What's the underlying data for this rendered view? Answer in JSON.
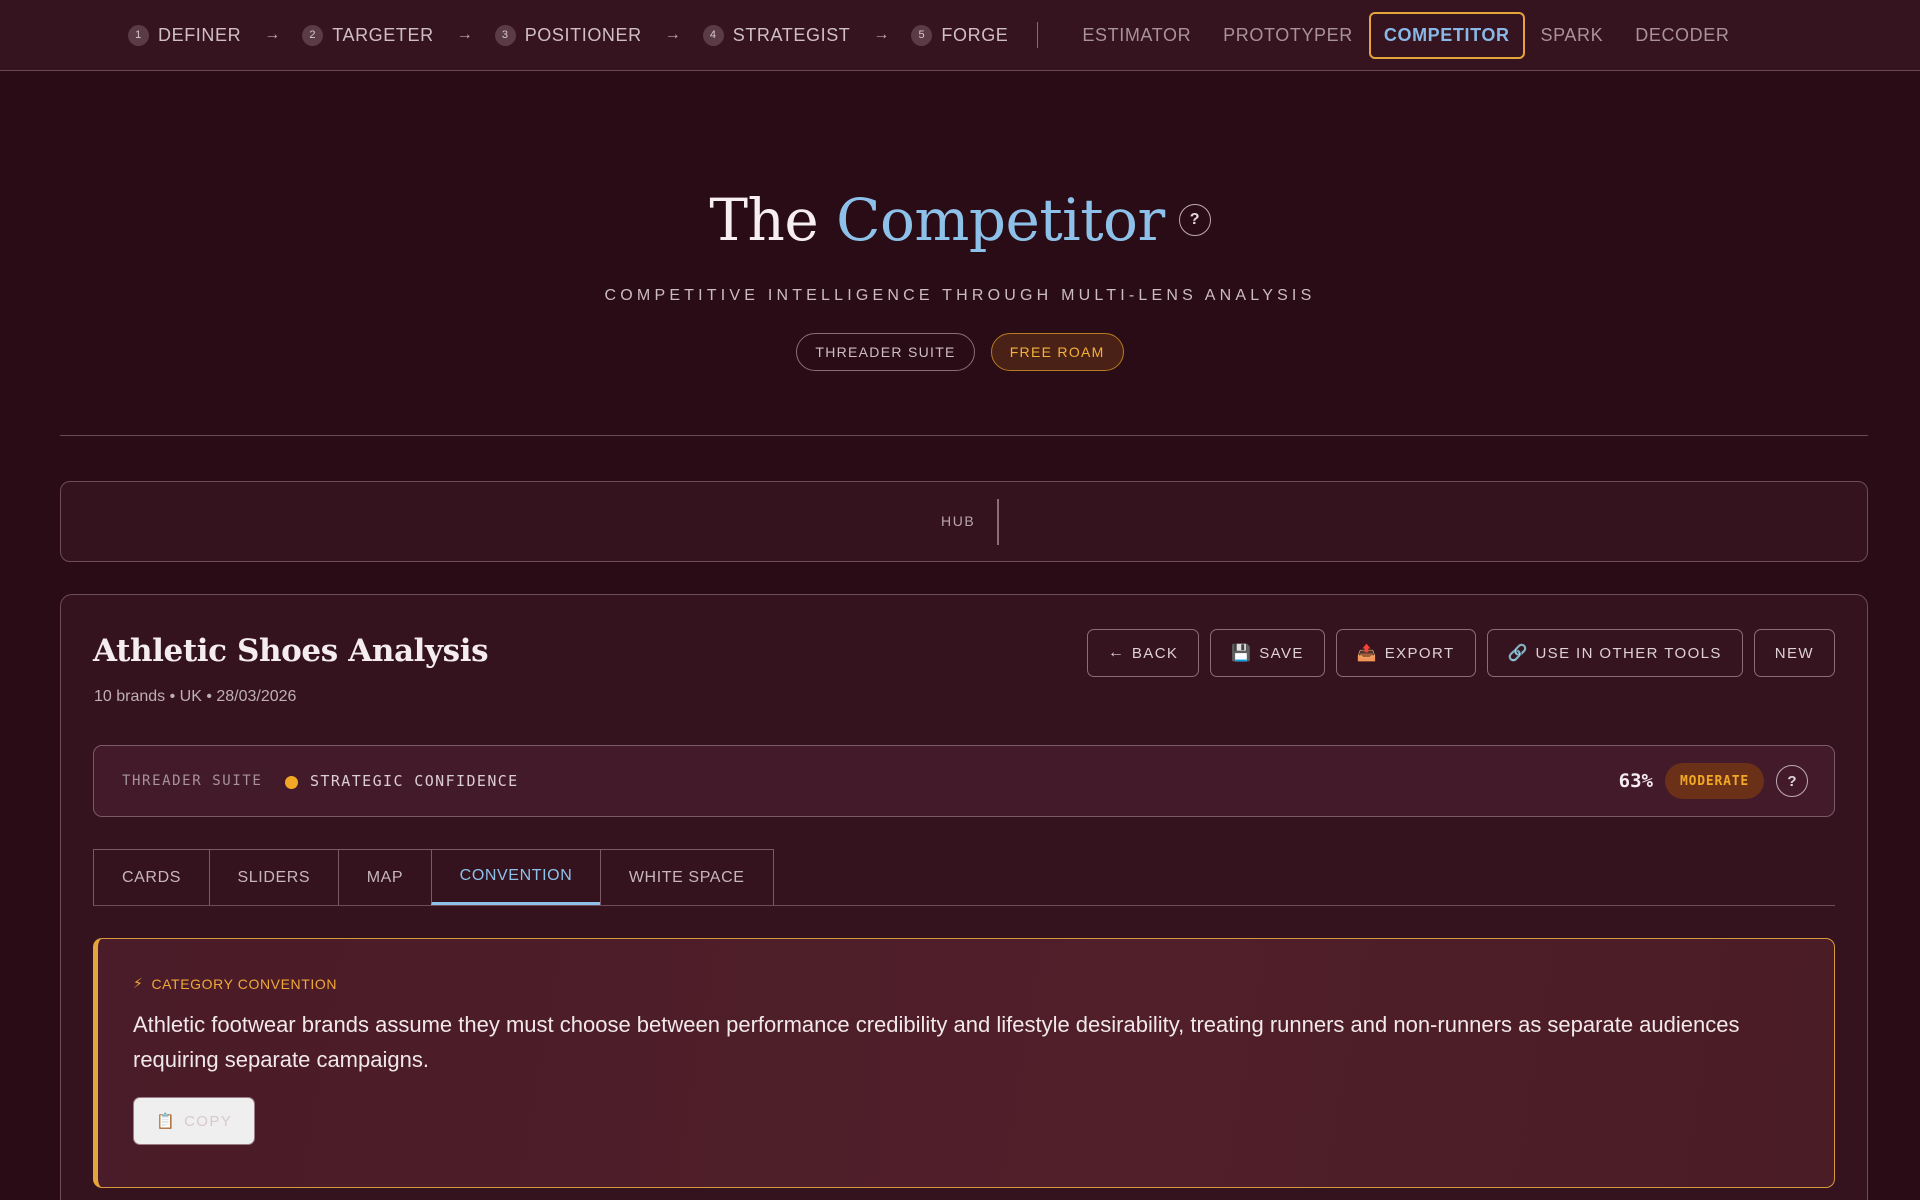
{
  "nav": {
    "steps": [
      {
        "num": "1",
        "label": "DEFINER"
      },
      {
        "num": "2",
        "label": "TARGETER"
      },
      {
        "num": "3",
        "label": "POSITIONER"
      },
      {
        "num": "4",
        "label": "STRATEGIST"
      },
      {
        "num": "5",
        "label": "FORGE"
      }
    ],
    "arrow": "→",
    "tools": [
      {
        "label": "ESTIMATOR"
      },
      {
        "label": "PROTOTYPER"
      },
      {
        "label": "COMPETITOR"
      },
      {
        "label": "SPARK"
      },
      {
        "label": "DECODER"
      }
    ],
    "active_tool": "COMPETITOR"
  },
  "hero": {
    "title_prefix": "The",
    "title_accent": "Competitor",
    "help": "?",
    "subtitle": "COMPETITIVE INTELLIGENCE THROUGH MULTI-LENS ANALYSIS",
    "badge_suite": "THREADER SUITE",
    "badge_roam": "FREE ROAM"
  },
  "hub": {
    "label": "HUB"
  },
  "analysis": {
    "title": "Athletic Shoes Analysis",
    "meta": "10 brands • UK • 28/03/2026",
    "actions": {
      "back": {
        "icon": "←",
        "label": "BACK"
      },
      "save": {
        "icon": "💾",
        "label": "SAVE"
      },
      "export": {
        "icon": "📤",
        "label": "EXPORT"
      },
      "use": {
        "icon": "🔗",
        "label": "USE IN OTHER TOOLS"
      },
      "new": {
        "label": "NEW"
      }
    }
  },
  "confidence": {
    "suite": "THREADER SUITE",
    "label": "STRATEGIC CONFIDENCE",
    "percent": "63%",
    "level": "MODERATE",
    "help": "?",
    "colors": {
      "dot": "#f2a826",
      "badge_text": "#f2a826"
    }
  },
  "tabs": [
    {
      "label": "CARDS"
    },
    {
      "label": "SLIDERS"
    },
    {
      "label": "MAP"
    },
    {
      "label": "CONVENTION"
    },
    {
      "label": "WHITE SPACE"
    }
  ],
  "active_tab": "CONVENTION",
  "convention": {
    "icon": "⚡",
    "kicker": "CATEGORY CONVENTION",
    "text": "Athletic footwear brands assume they must choose between performance credibility and lifestyle desirability, treating runners and non-runners as separate audiences requiring separate campaigns.",
    "copy_icon": "📋",
    "copy_label": "COPY"
  },
  "theme": {
    "background": "#2a0c16",
    "accent_blue": "#8ec1ea",
    "accent_orange": "#e6a53a"
  }
}
